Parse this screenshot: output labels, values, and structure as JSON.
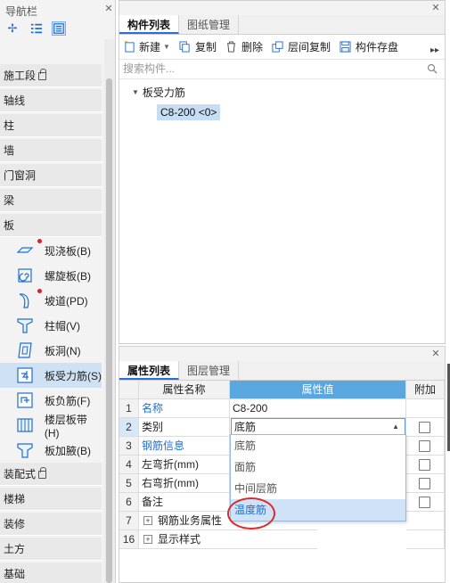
{
  "nav": {
    "title": "导航栏",
    "categories": [
      {
        "label": "施工段",
        "lock": true
      },
      {
        "label": "轴线",
        "lock": false
      },
      {
        "label": "柱",
        "lock": false
      },
      {
        "label": "墙",
        "lock": false
      },
      {
        "label": "门窗洞",
        "lock": false
      },
      {
        "label": "梁",
        "lock": false
      },
      {
        "label": "板",
        "lock": false
      }
    ],
    "items": [
      {
        "label": "现浇板(B)",
        "icon": "cast-slab-icon",
        "dot": true
      },
      {
        "label": "螺旋板(B)",
        "icon": "spiral-slab-icon",
        "dot": false
      },
      {
        "label": "坡道(PD)",
        "icon": "ramp-icon",
        "dot": true
      },
      {
        "label": "柱帽(V)",
        "icon": "column-cap-icon",
        "dot": false
      },
      {
        "label": "板洞(N)",
        "icon": "slab-hole-icon",
        "dot": false
      },
      {
        "label": "板受力筋(S)",
        "icon": "slab-rebar-icon",
        "dot": false,
        "selected": true
      },
      {
        "label": "板负筋(F)",
        "icon": "negative-rebar-icon",
        "dot": false
      },
      {
        "label": "楼层板带(H)",
        "icon": "floor-strip-icon",
        "dot": false
      },
      {
        "label": "板加腋(B)",
        "icon": "slab-haunch-icon",
        "dot": false
      }
    ],
    "bottom_categories": [
      {
        "label": "装配式",
        "lock": true
      },
      {
        "label": "楼梯",
        "lock": false
      },
      {
        "label": "装修",
        "lock": false
      },
      {
        "label": "土方",
        "lock": false
      },
      {
        "label": "基础",
        "lock": false
      }
    ]
  },
  "component_panel": {
    "tabs": [
      "构件列表",
      "图纸管理"
    ],
    "toolbar": {
      "new": "新建",
      "copy": "复制",
      "delete": "删除",
      "floor_copy": "层间复制",
      "save": "构件存盘"
    },
    "search_placeholder": "搜索构件...",
    "tree_parent": "板受力筋",
    "tree_child": "C8-200 <0>"
  },
  "property_panel": {
    "tabs": [
      "属性列表",
      "图层管理"
    ],
    "headers": {
      "name": "属性名称",
      "value": "属性值",
      "extra": "附加"
    },
    "rows": [
      {
        "num": "1",
        "name": "名称",
        "value": "C8-200"
      },
      {
        "num": "2",
        "name": "类别",
        "value": "底筋"
      },
      {
        "num": "3",
        "name": "钢筋信息",
        "value": ""
      },
      {
        "num": "4",
        "name": "左弯折(mm)",
        "value": ""
      },
      {
        "num": "5",
        "name": "右弯折(mm)",
        "value": ""
      },
      {
        "num": "6",
        "name": "备注",
        "value": ""
      },
      {
        "num": "7",
        "name": "钢筋业务属性",
        "value": ""
      },
      {
        "num": "16",
        "name": "显示样式",
        "value": ""
      }
    ],
    "dropdown_options": [
      "底筋",
      "面筋",
      "中间层筋",
      "温度筋"
    ],
    "highlighted_option": "温度筋"
  },
  "colors": {
    "accent": "#1e6fcf",
    "header_blue": "#5aa7e0",
    "selected_bg": "#cfe2f4",
    "annotation_red": "#d92b2b"
  }
}
